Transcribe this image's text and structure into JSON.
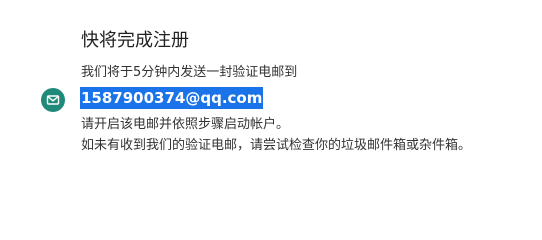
{
  "heading": "快将完成注册",
  "message": {
    "line1": "我们将于5分钟内发送一封验证电邮到",
    "email": "1587900374@qq.com",
    "line3": "请开启该电邮并依照步骤启动帐户。",
    "line4": "如未有收到我们的验证电邮，请尝试检查你的垃圾邮件箱或杂件箱。"
  },
  "icons": {
    "mail": "envelope-icon"
  },
  "colors": {
    "icon_circle": "#1f8a7a",
    "email_highlight": "#1a73e8",
    "text": "#333333"
  }
}
